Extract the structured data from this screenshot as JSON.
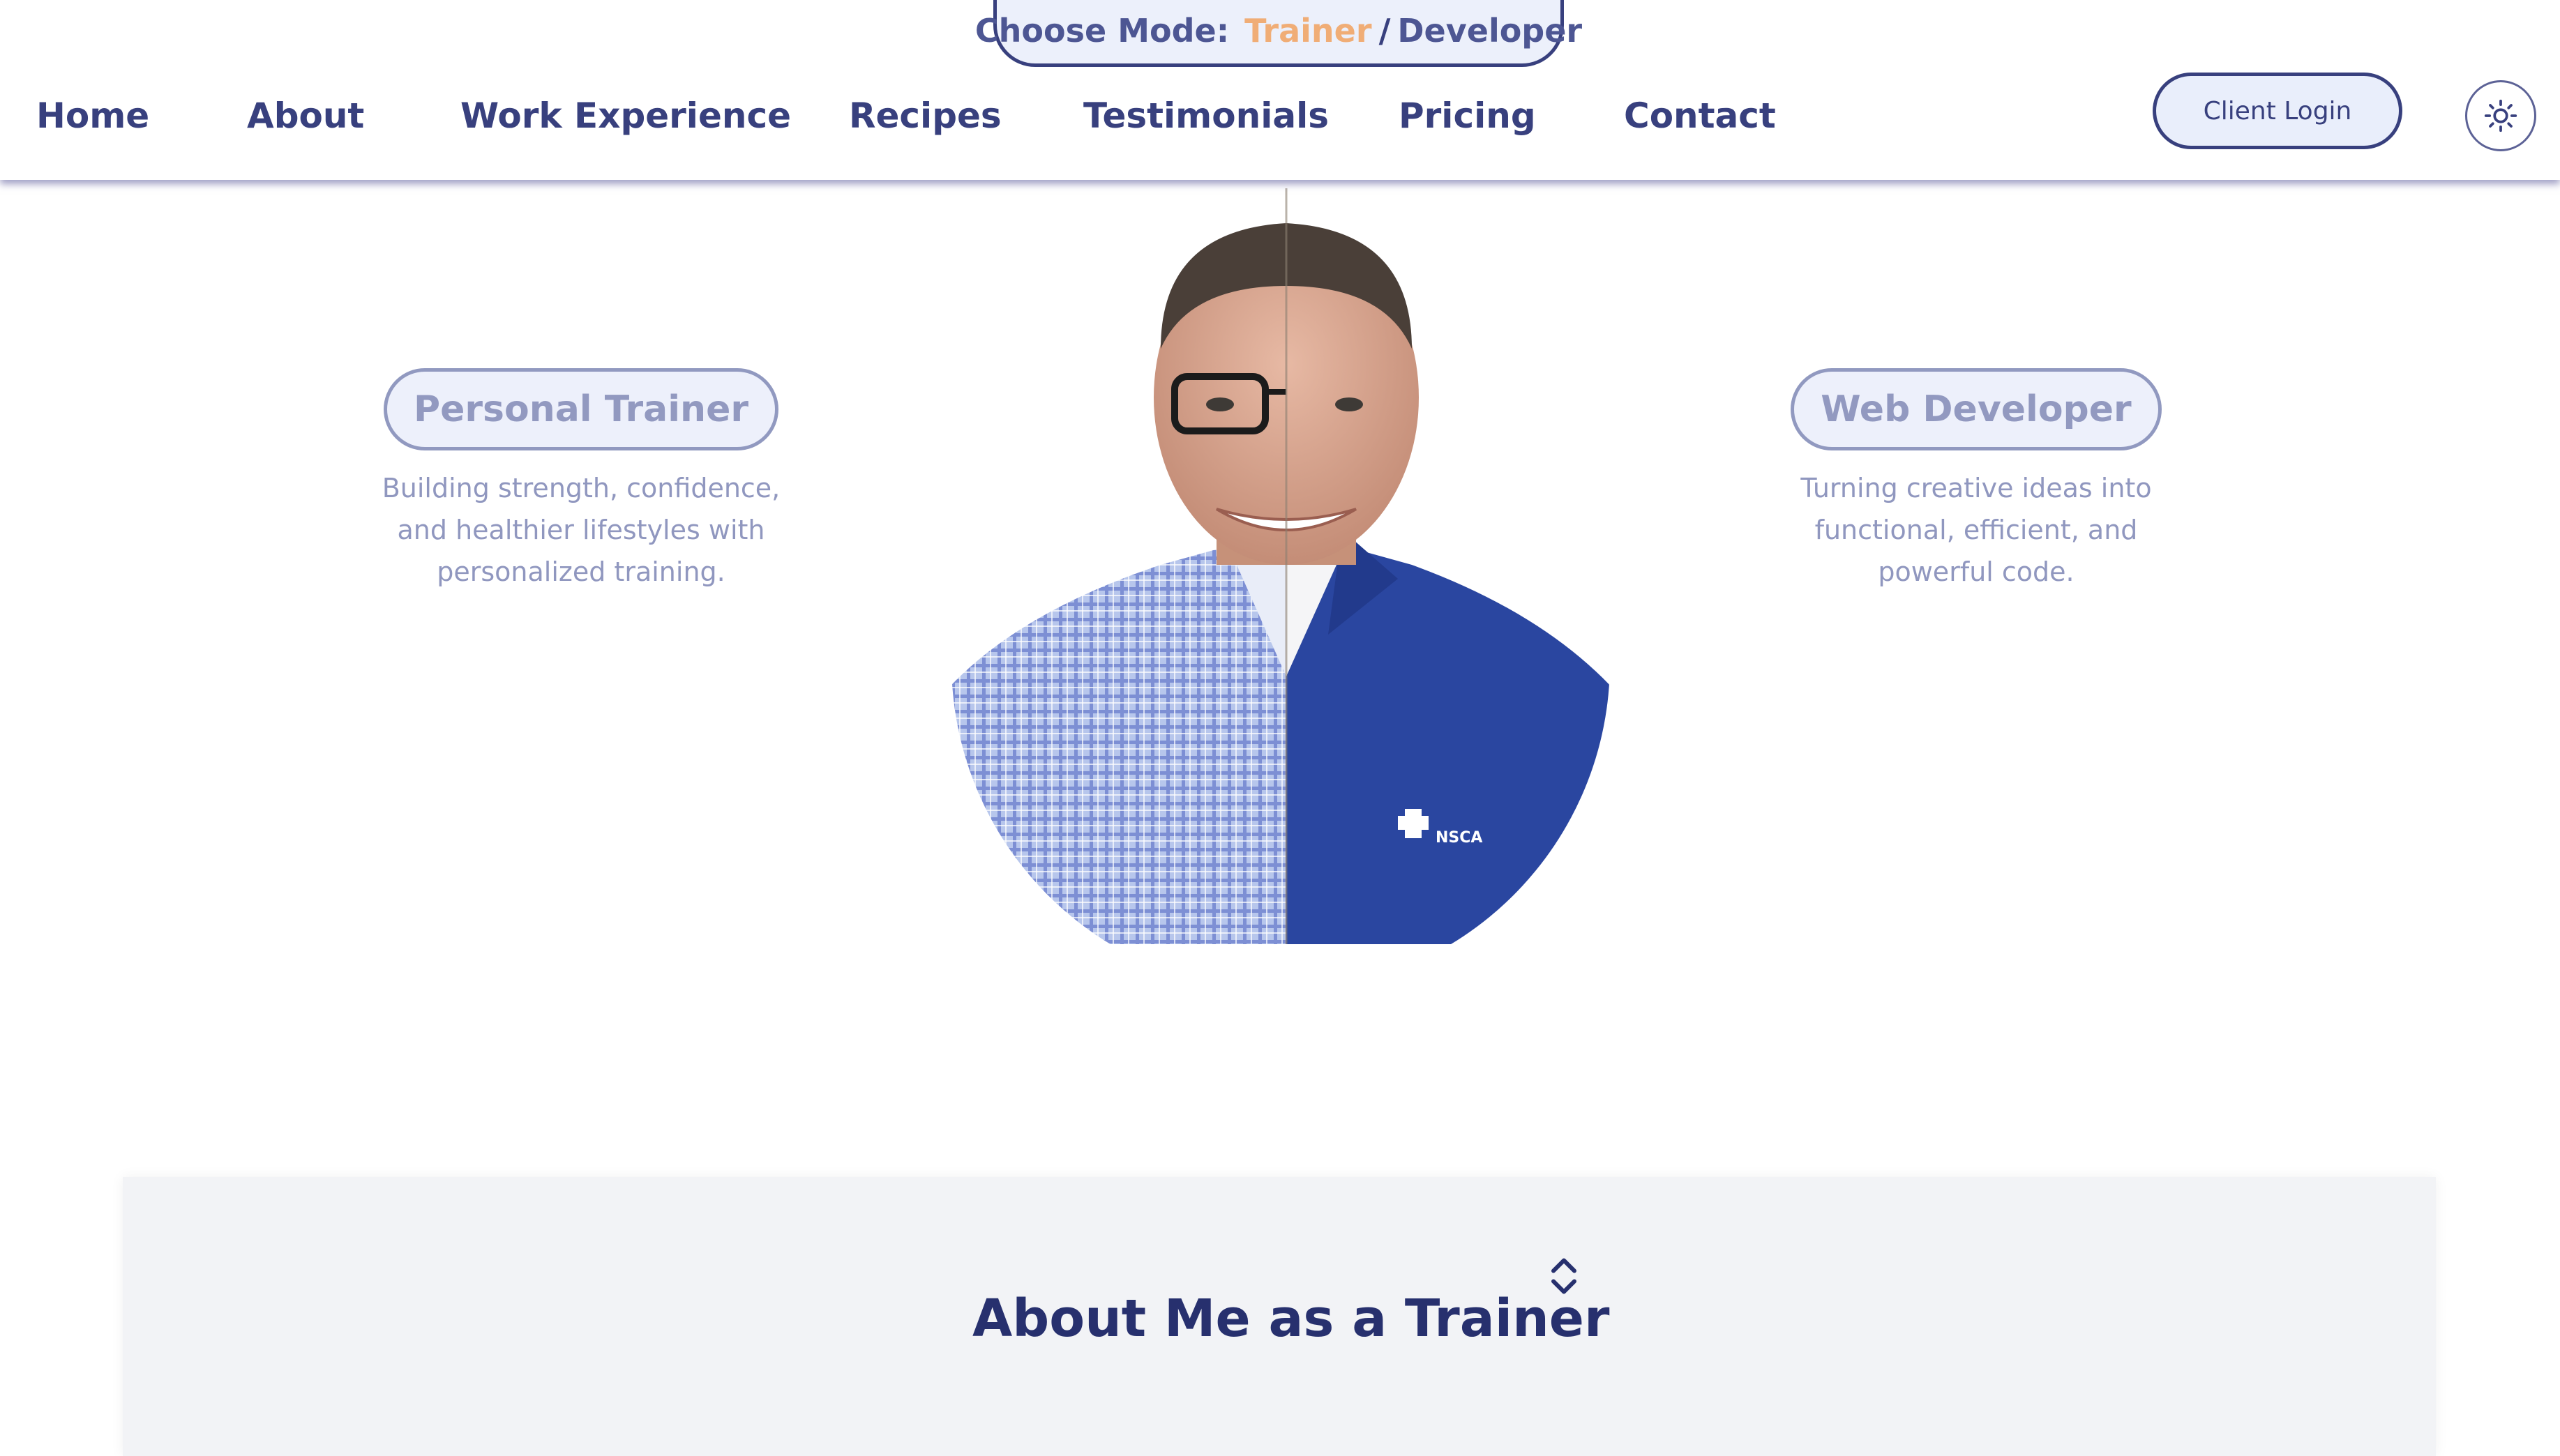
{
  "mode_switch": {
    "label": "Choose Mode:",
    "trainer": "Trainer",
    "separator": "/",
    "developer": "Developer"
  },
  "nav": {
    "home": "Home",
    "about": "About",
    "work_experience": "Work Experience",
    "recipes": "Recipes",
    "testimonials": "Testimonials",
    "pricing": "Pricing",
    "contact": "Contact"
  },
  "header_actions": {
    "client_login": "Client Login",
    "theme_icon": "sun-icon"
  },
  "hero": {
    "trainer": {
      "title": "Personal Trainer",
      "description": "Building strength, confidence, and healthier lifestyles with personalized training."
    },
    "developer": {
      "title": "Web Developer",
      "description": "Turning creative ideas into functional, efficient, and powerful code."
    },
    "portrait_logo": "NSCA"
  },
  "about": {
    "title": "About Me as a Trainer",
    "toggle_icon": "chevron-up-down-icon"
  },
  "colors": {
    "navy": "#38407e",
    "orange_accent": "#f0ad76",
    "muted_lavender": "#9299c0",
    "pill_background": "#ecf0fb",
    "polo_blue": "#2a46a0",
    "card_background": "#f2f3f6"
  }
}
